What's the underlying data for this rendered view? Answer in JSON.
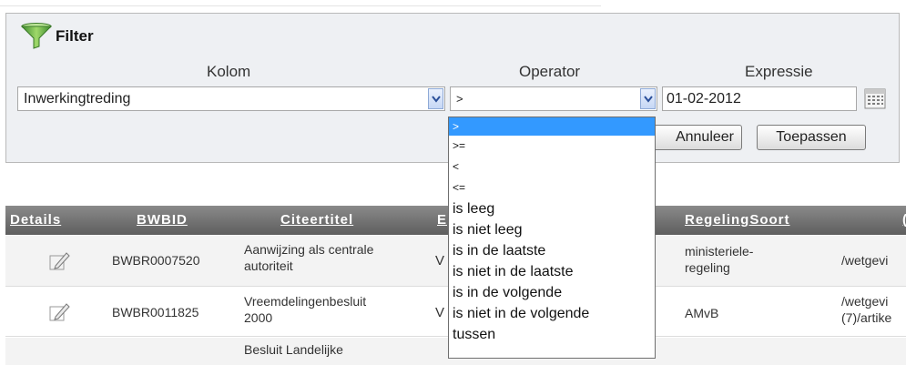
{
  "filter": {
    "title": "Filter",
    "kolom_label": "Kolom",
    "operator_label": "Operator",
    "expressie_label": "Expressie",
    "kolom_value": "Inwerkingtreding",
    "operator_value": ">",
    "expressie_value": "01-02-2012",
    "annuleer_label": "Annuleer",
    "toepassen_label": "Toepassen"
  },
  "operator_options": [
    ">",
    ">=",
    "<",
    "<=",
    "is leeg",
    "is niet leeg",
    "is in de laatste",
    "is niet in de laatste",
    "is in de volgende",
    "is niet in de volgende",
    "tussen"
  ],
  "table": {
    "headers": {
      "details": "Details",
      "bwbid": "BWBID",
      "citeertitel": "Citeertitel",
      "e": "E",
      "regelingsoort": "RegelingSoort",
      "more": "("
    },
    "rows": [
      {
        "bwbid": "BWBR0007520",
        "titel_1": "Aanwijzing als centrale",
        "titel_2": "autoriteit",
        "v": "V",
        "soort_1": "ministeriele-",
        "soort_2": "regeling",
        "path_1": "/wetgevi",
        "path_2": ""
      },
      {
        "bwbid": "BWBR0011825",
        "titel_1": "Vreemdelingenbesluit",
        "titel_2": "2000",
        "v": "V",
        "soort_1": "AMvB",
        "soort_2": "",
        "path_1": "/wetgevi",
        "path_2": "(7)/artike"
      },
      {
        "bwbid": "",
        "titel_1": "Besluit Landelijke",
        "titel_2": "",
        "v": "",
        "soort_1": "",
        "soort_2": "",
        "path_1": "",
        "path_2": ""
      }
    ]
  },
  "colors": {
    "selected_option": "#3399ff",
    "header_bg": "#6e6e6e",
    "panel_bg": "#eef0f3"
  }
}
